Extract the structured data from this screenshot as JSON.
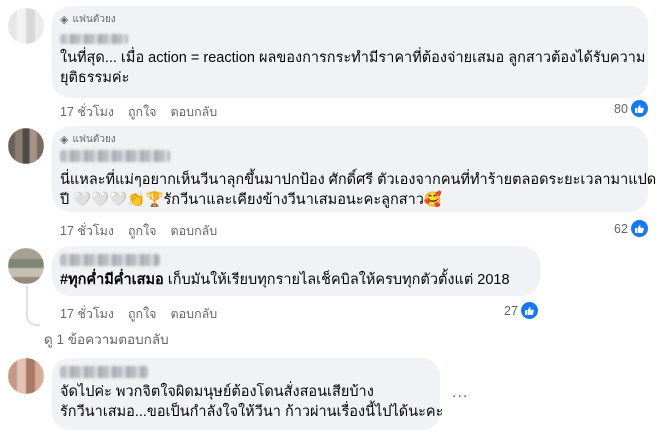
{
  "comments": [
    {
      "badge": "แฟนตัวยง",
      "name_partial": "สมใจ ...",
      "lines": [
        "ในที่สุด...  เมื่อ action = reaction ผลของการกระทำมีราคาที่ต้องจ่ายเสมอ ลูกสาวต้องได้รับความ",
        "ยุติธรรมค่ะ"
      ],
      "time": "17 ชั่วโมง",
      "like_label": "ถูกใจ",
      "reply_label": "ตอบกลับ",
      "reaction_count": "80"
    },
    {
      "badge": "แฟนตัวยง",
      "lines": [
        "นี่แหละที่แม่ๆอยากเห็นวีนาลุกขึ้นมาปกป้อง ศักดิ์ศรี ตัวเองจากคนที่ทำร้ายตลอดระยะเวลามาแปด",
        "ปี 🤍🤍🤍👏🏆รักวีนาและเคียงข้างวีนาเสมอนะคะลูกสาว🥰"
      ],
      "time": "17 ชั่วโมง",
      "like_label": "ถูกใจ",
      "reply_label": "ตอบกลับ",
      "reaction_count": "62"
    },
    {
      "hashtag": "#ทุกค่ำมีค่ำเสมอ",
      "rest": " เก็บมันให้เรียบทุกรายไลเช็คบิลให้ครบทุกตัวตั้งแต่ 2018",
      "time": "17 ชั่วโมง",
      "like_label": "ถูกใจ",
      "reply_label": "ตอบกลับ",
      "reaction_count": "27",
      "view_replies": "ดู 1 ข้อความตอบกลับ"
    },
    {
      "lines": [
        "จัดไปค่ะ พวกจิตใจผิดมนุษย์ต้องโดนสั่งสอนเสียบ้าง",
        "รักวีนาเสมอ...ขอเป็นกำลังใจให้วีนา ก้าวผ่านเรื่องนี้ไปได้นะคะ"
      ],
      "more": "..."
    }
  ],
  "colors": {
    "bubble": "#f0f2f5",
    "meta": "#65676b",
    "like": "#1877f2"
  }
}
